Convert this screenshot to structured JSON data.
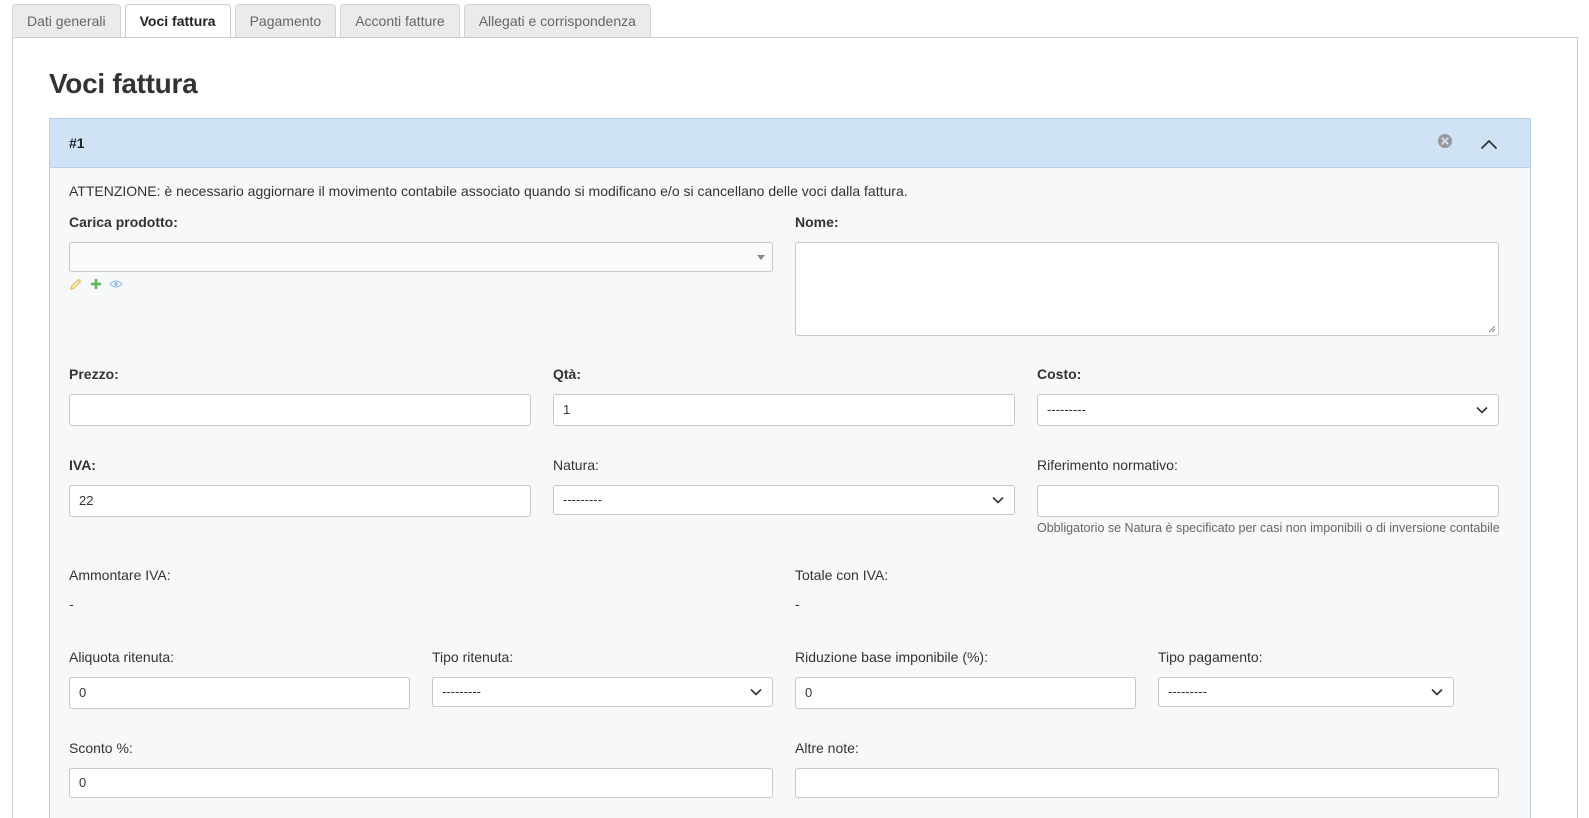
{
  "tabs": [
    {
      "label": "Dati generali",
      "active": false
    },
    {
      "label": "Voci fattura",
      "active": true
    },
    {
      "label": "Pagamento",
      "active": false
    },
    {
      "label": "Acconti fatture",
      "active": false
    },
    {
      "label": "Allegati e corrispondenza",
      "active": false
    }
  ],
  "page": {
    "title": "Voci fattura"
  },
  "item": {
    "number": "#1",
    "notice": "ATTENZIONE: è necessario aggiornare il movimento contabile associato quando si modificano e/o si cancellano delle voci dalla fattura.",
    "product": {
      "label": "Carica prodotto:",
      "value": ""
    },
    "nome": {
      "label": "Nome:",
      "value": ""
    },
    "prezzo": {
      "label": "Prezzo:",
      "value": ""
    },
    "qta": {
      "label": "Qtà:",
      "value": "1"
    },
    "costo": {
      "label": "Costo:",
      "value": "---------"
    },
    "iva": {
      "label": "IVA:",
      "value": "22"
    },
    "natura": {
      "label": "Natura:",
      "value": "---------"
    },
    "riferimento": {
      "label": "Riferimento normativo:",
      "value": "",
      "help": "Obbligatorio se Natura è specificato per casi non imponibili o di inversione contabile"
    },
    "ammontare_iva": {
      "label": "Ammontare IVA:",
      "value": "-"
    },
    "totale_iva": {
      "label": "Totale con IVA:",
      "value": "-"
    },
    "aliquota_ritenuta": {
      "label": "Aliquota ritenuta:",
      "value": "0"
    },
    "tipo_ritenuta": {
      "label": "Tipo ritenuta:",
      "value": "---------"
    },
    "riduzione": {
      "label": "Riduzione base imponibile (%):",
      "value": "0"
    },
    "tipo_pagamento": {
      "label": "Tipo pagamento:",
      "value": "---------"
    },
    "sconto": {
      "label": "Sconto %:",
      "value": "0"
    },
    "altre_note": {
      "label": "Altre note:",
      "value": ""
    }
  },
  "icons": {
    "remove": "close-circle-icon",
    "collapse": "chevron-up-icon",
    "edit": "pencil-icon",
    "add": "plus-icon",
    "view": "eye-icon"
  },
  "colors": {
    "header_bg": "#cfe2f6",
    "edit": "#e8c35a",
    "add": "#5cb85c",
    "view": "#9fc3e6"
  }
}
